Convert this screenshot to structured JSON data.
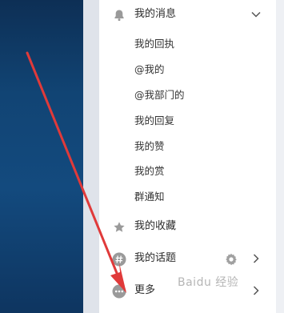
{
  "menu": {
    "messages": {
      "label": "我的消息",
      "icon": "bell-icon"
    },
    "sub_items": [
      "我的回执",
      "@我的",
      "@我部门的",
      "我的回复",
      "我的赞",
      "我的赏",
      "群通知"
    ],
    "favorites": {
      "label": "我的收藏",
      "icon": "star-icon"
    },
    "topics": {
      "label": "我的话题",
      "icon": "hash-icon"
    },
    "more": {
      "label": "更多",
      "icon": "more-icon"
    }
  },
  "colors": {
    "panel_bg": "#ffffff",
    "desktop_bg": "#134a7e",
    "arrow": "#e03a3a",
    "icon_grey": "#9a9a9a"
  },
  "watermark": "Baidu 经验"
}
